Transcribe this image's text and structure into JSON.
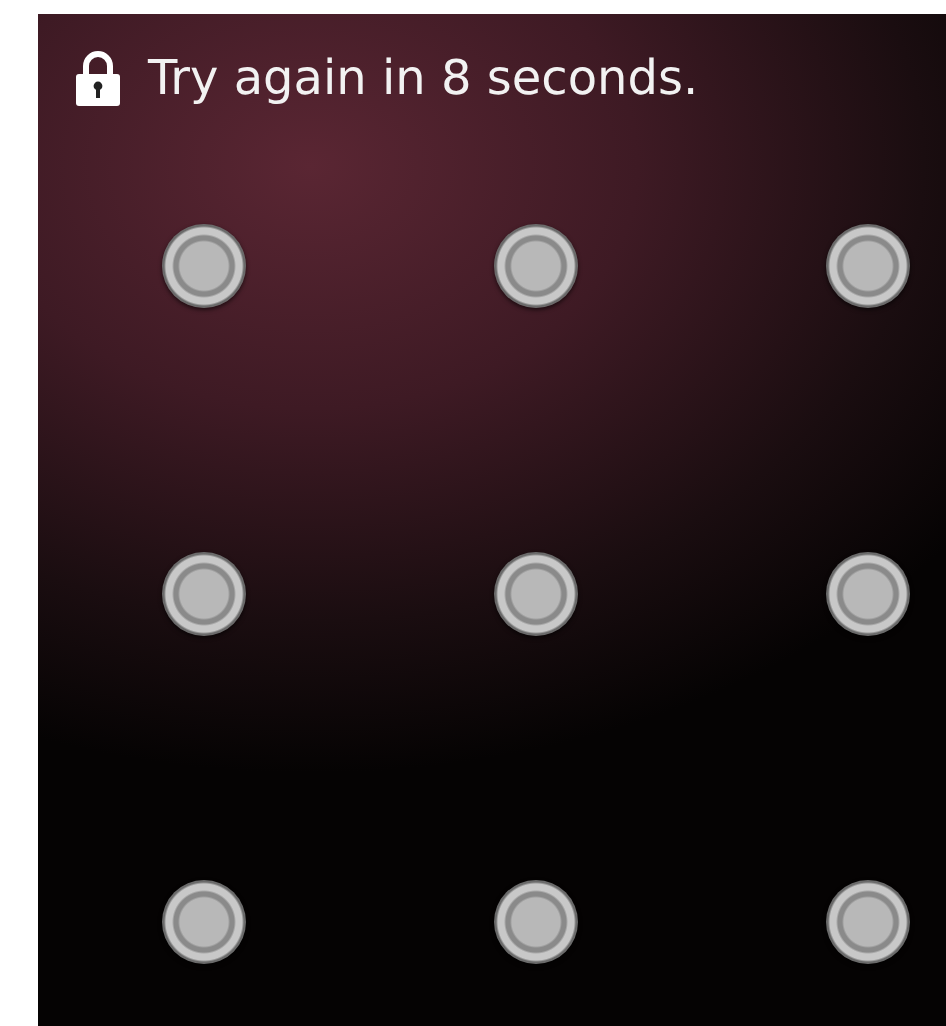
{
  "lock_screen": {
    "message": "Try again in 8 seconds."
  },
  "pattern": {
    "dots": [
      {
        "selected": false
      },
      {
        "selected": false
      },
      {
        "selected": false
      },
      {
        "selected": false
      },
      {
        "selected": false
      },
      {
        "selected": false
      },
      {
        "selected": false
      },
      {
        "selected": false
      },
      {
        "selected": false
      }
    ]
  }
}
